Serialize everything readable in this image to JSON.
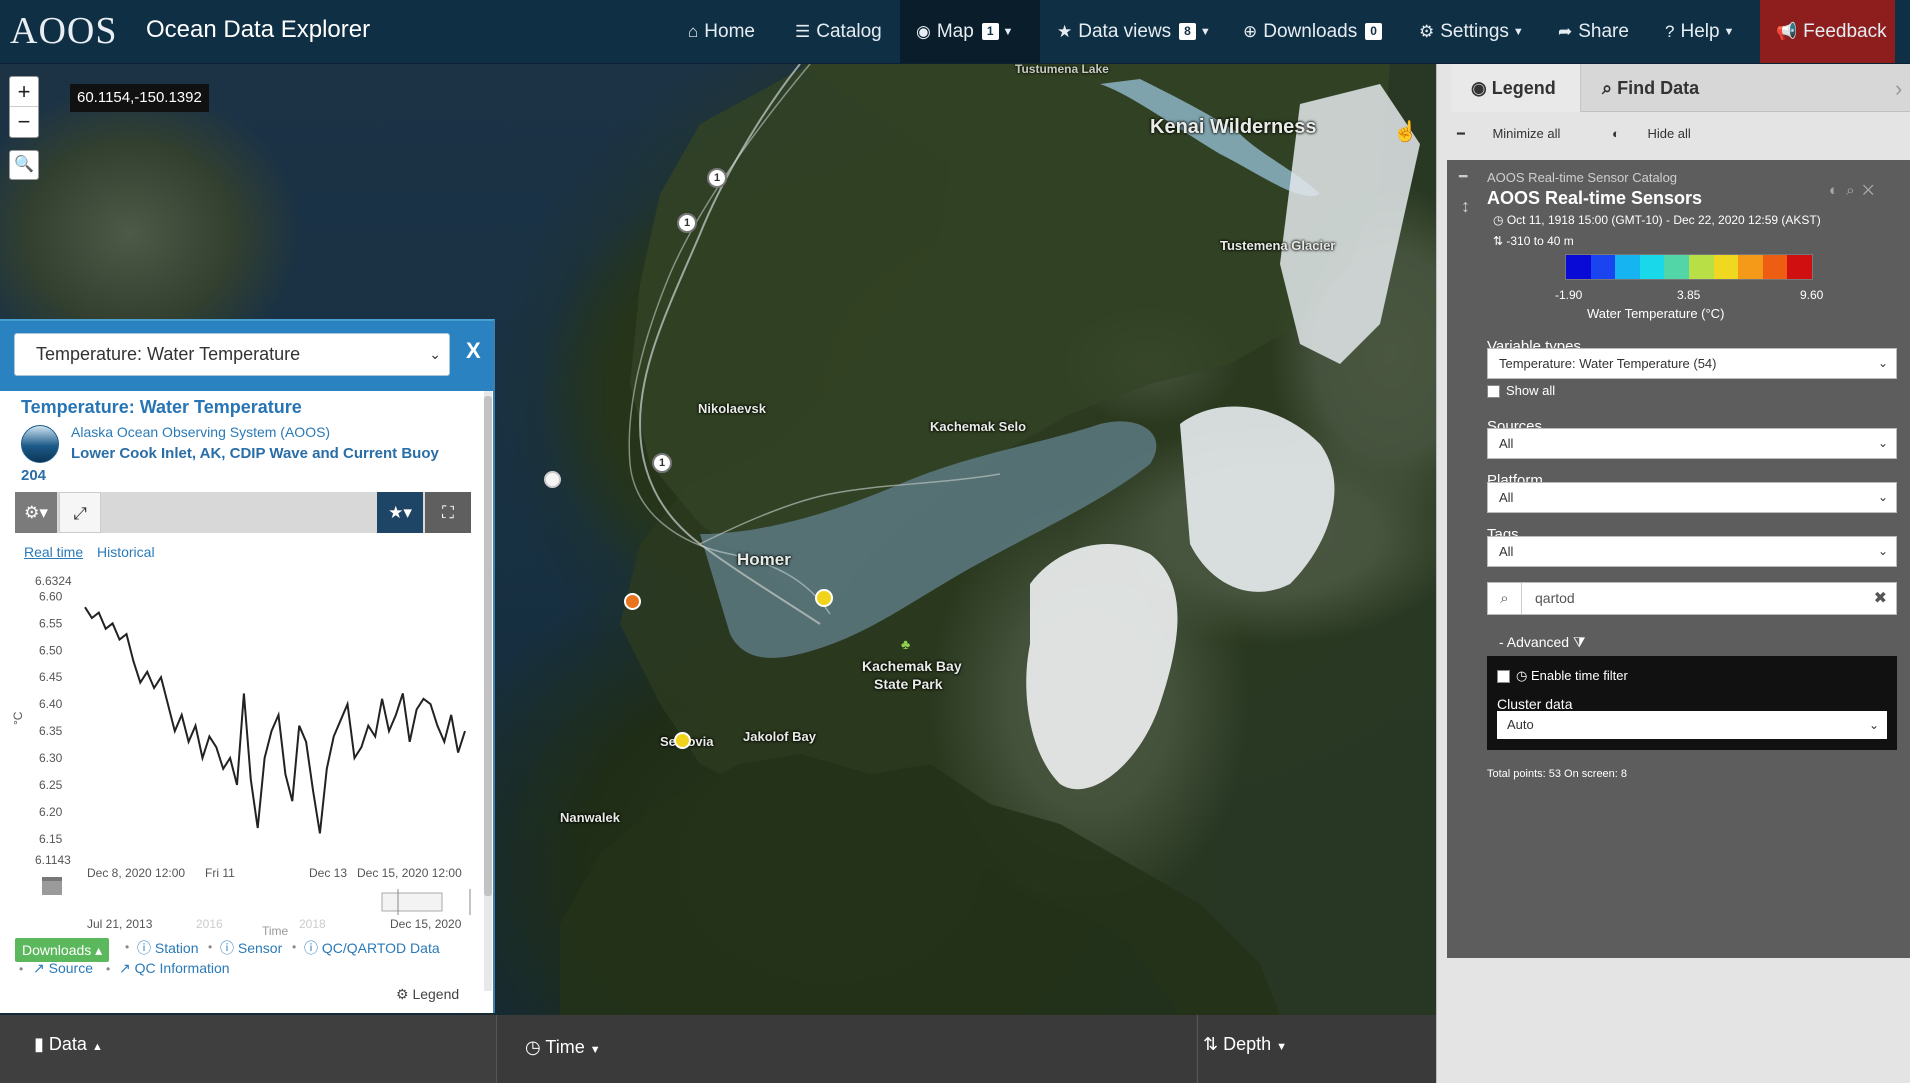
{
  "navbar": {
    "logo": "AOOS",
    "app_title": "Ocean Data Explorer",
    "items": {
      "home": "Home",
      "catalog": "Catalog",
      "map": "Map",
      "map_badge": "1",
      "data_views": "Data views",
      "data_views_badge": "8",
      "downloads": "Downloads",
      "downloads_badge": "0",
      "settings": "Settings",
      "share": "Share",
      "help": "Help",
      "feedback": "Feedback"
    }
  },
  "map": {
    "coordinates": "60.1154,-150.1392",
    "zoom_in": "+",
    "zoom_out": "−",
    "labels": {
      "tustumena_lake": "Tustumena Lake",
      "kenai_wilderness": "Kenai Wilderness",
      "tustemena_glacier": "Tustemena Glacier",
      "nikolaevsk": "Nikolaevsk",
      "kachemak_selo": "Kachemak Selo",
      "homer": "Homer",
      "kachemak_bay": "Kachemak Bay",
      "state_park": "State Park",
      "jakolof_bay": "Jakolof Bay",
      "seldovia": "Seldovia",
      "nanwalek": "Nanwalek"
    },
    "cluster_count": "1",
    "colors": {
      "orange": "#e8741d",
      "yellow": "#f2d31b",
      "white": "#f5f5f5"
    }
  },
  "data_panel": {
    "variable_select": "Temperature: Water Temperature",
    "close": "X",
    "title": "Temperature: Water Temperature",
    "organization": "Alaska Ocean Observing System (AOOS)",
    "station": "Lower Cook Inlet, AK, CDIP Wave and Current Buoy",
    "station_id": "204",
    "tabs": {
      "realtime": "Real time",
      "historical": "Historical"
    },
    "downloads_button": "Downloads",
    "links": {
      "station": "Station",
      "sensor": "Sensor",
      "qc_data": "QC/QARTOD Data",
      "source": "Source",
      "qc_info": "QC Information"
    },
    "legend": "Legend"
  },
  "chart_data": {
    "type": "line",
    "ylabel": "°C",
    "xlabel": "Time",
    "y_max_label": "6.6324",
    "y_min_label": "6.1143",
    "ylim": [
      6.1143,
      6.6324
    ],
    "y_ticks": [
      "6.60",
      "6.55",
      "6.50",
      "6.45",
      "6.40",
      "6.35",
      "6.30",
      "6.25",
      "6.20",
      "6.15"
    ],
    "x_ticks": [
      "Dec 8, 2020 12:00",
      "Fri 11",
      "Dec 13",
      "Dec 15, 2020 12:00"
    ],
    "navigator": {
      "start": "Jul 21, 2013",
      "ticks": [
        "2016",
        "2018"
      ],
      "end": "Dec 15, 2020"
    },
    "series": [
      {
        "values": [
          6.58,
          6.56,
          6.57,
          6.54,
          6.55,
          6.52,
          6.53,
          6.48,
          6.44,
          6.46,
          6.43,
          6.45,
          6.4,
          6.35,
          6.38,
          6.33,
          6.36,
          6.3,
          6.34,
          6.32,
          6.28,
          6.3,
          6.25,
          6.42,
          6.26,
          6.17,
          6.3,
          6.35,
          6.38,
          6.27,
          6.22,
          6.36,
          6.33,
          6.24,
          6.16,
          6.28,
          6.34,
          6.37,
          6.4,
          6.3,
          6.32,
          6.36,
          6.34,
          6.41,
          6.35,
          6.38,
          6.42,
          6.33,
          6.39,
          6.41,
          6.4,
          6.36,
          6.33,
          6.38,
          6.31,
          6.35
        ]
      }
    ]
  },
  "bottom_bar": {
    "data": "Data",
    "time": "Time",
    "depth": "Depth"
  },
  "sidebar": {
    "tabs": {
      "legend": "Legend",
      "find_data": "Find Data"
    },
    "minimize_all": "Minimize all",
    "hide_all": "Hide all",
    "layer": {
      "catalog": "AOOS Real-time Sensor Catalog",
      "title": "AOOS Real-time Sensors",
      "time_range": "Oct 11, 1918 15:00 (GMT-10) - Dec 22, 2020 12:59 (AKST)",
      "depth_range": "-310 to 40 m",
      "colorbar": {
        "min": "-1.90",
        "mid": "3.85",
        "max": "9.60",
        "label": "Water Temperature (°C)",
        "colors": [
          "#0a0ad6",
          "#1a44f0",
          "#16b4f0",
          "#19d8ea",
          "#52d6a8",
          "#b8e046",
          "#f0d820",
          "#f59a18",
          "#ee5e12",
          "#d01010"
        ]
      }
    },
    "variable_types_label": "Variable types",
    "variable_types_value": "Temperature: Water Temperature (54)",
    "show_all": "Show all",
    "sources_label": "Sources",
    "sources_value": "All",
    "platform_label": "Platform",
    "platform_value": "All",
    "tags_label": "Tags",
    "tags_value": "All",
    "search_value": "qartod",
    "advanced": "Advanced",
    "enable_time_filter": "Enable time filter",
    "cluster_label": "Cluster data",
    "cluster_value": "Auto",
    "total_points": "Total points: 53 On screen: 8"
  }
}
